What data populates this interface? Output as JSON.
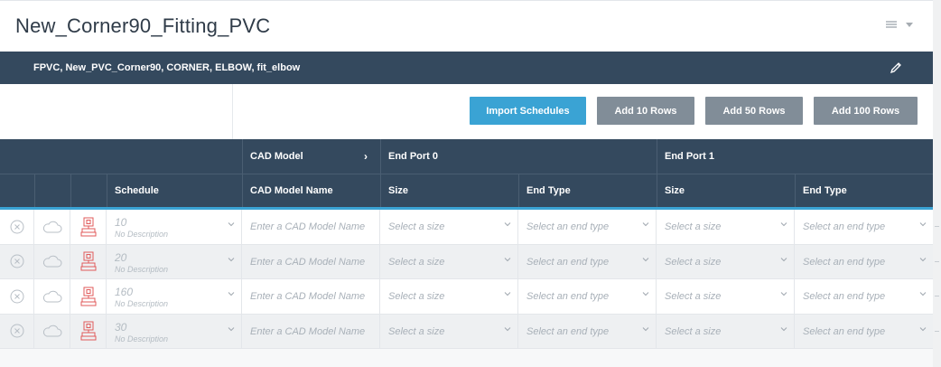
{
  "header": {
    "title": "New_Corner90_Fitting_PVC",
    "menu_icon": "hamburger-icon",
    "menu_caret_icon": "caret-down-icon"
  },
  "subbar": {
    "text": "FPVC, New_PVC_Corner90, CORNER, ELBOW, fit_elbow",
    "edit_icon": "pencil-icon"
  },
  "toolbar": {
    "import_label": "Import Schedules",
    "add10_label": "Add 10 Rows",
    "add50_label": "Add 50 Rows",
    "add100_label": "Add 100 Rows"
  },
  "table": {
    "group_headers": {
      "cad_model": "CAD Model",
      "end_port_0": "End Port 0",
      "end_port_1": "End Port 1"
    },
    "column_headers": {
      "schedule": "Schedule",
      "cad_model_name": "CAD Model Name",
      "size_0": "Size",
      "end_type_0": "End Type",
      "size_1": "Size",
      "end_type_1": "End Type"
    },
    "placeholders": {
      "cad_model_name": "Enter a CAD Model Name",
      "size": "Select a size",
      "end_type": "Select an end type"
    },
    "rows": [
      {
        "schedule": "10",
        "description": "No Description"
      },
      {
        "schedule": "20",
        "description": "No Description"
      },
      {
        "schedule": "160",
        "description": "No Description"
      },
      {
        "schedule": "30",
        "description": "No Description"
      }
    ]
  },
  "colors": {
    "header_dark": "#34495e",
    "accent_blue": "#3aa3d4",
    "button_gray": "#818d98",
    "delete_red": "#e05a5a"
  }
}
